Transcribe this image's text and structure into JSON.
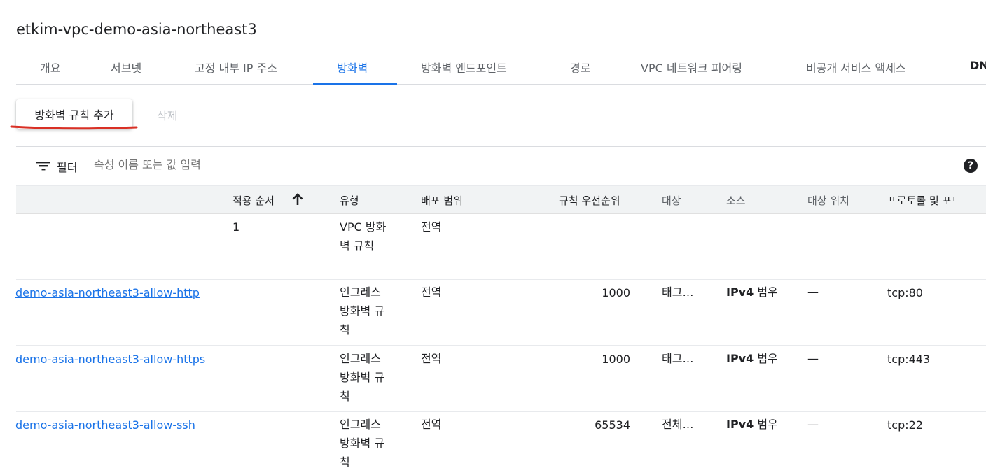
{
  "title": "etkim-vpc-demo-asia-northeast3",
  "tabs": [
    {
      "label": "개요"
    },
    {
      "label": "서브넷"
    },
    {
      "label": "고정 내부 IP 주소"
    },
    {
      "label": "방화벽"
    },
    {
      "label": "방화벽 엔드포인트"
    },
    {
      "label": "경로"
    },
    {
      "label": "VPC 네트워크 피어링"
    },
    {
      "label": "비공개 서비스 액세스"
    },
    {
      "label": "DN"
    }
  ],
  "active_tab": "방화벽",
  "toolbar": {
    "add_label": "방화벽 규칙 추가",
    "delete_label": "삭제"
  },
  "filter": {
    "label": "필터",
    "placeholder": "속성 이름 또는 값 입력"
  },
  "columns": {
    "order": "적용 순서",
    "type": "유형",
    "scope": "배포 범위",
    "priority": "규칙 우선순위",
    "target": "대상",
    "source": "소스",
    "target_location": "대상 위치",
    "protocol": "프로토콜 및 포트"
  },
  "rows": [
    {
      "name": "",
      "order": "1",
      "type": "VPC 방화벽 규칙",
      "scope": "전역",
      "priority": "",
      "target": "",
      "source_bold": "",
      "source_rest": "",
      "target_location": "",
      "protocol": ""
    },
    {
      "name": "demo-asia-northeast3-allow-http",
      "order": "",
      "type": "인그레스 방화벽 규칙",
      "scope": "전역",
      "priority": "1000",
      "target": "태그…",
      "source_bold": "IPv4",
      "source_rest": " 범우",
      "target_location": "—",
      "protocol": "tcp:80"
    },
    {
      "name": "demo-asia-northeast3-allow-https",
      "order": "",
      "type": "인그레스 방화벽 규칙",
      "scope": "전역",
      "priority": "1000",
      "target": "태그…",
      "source_bold": "IPv4",
      "source_rest": " 범우",
      "target_location": "—",
      "protocol": "tcp:443"
    },
    {
      "name": "demo-asia-northeast3-allow-ssh",
      "order": "",
      "type": "인그레스 방화벽 규칙",
      "scope": "전역",
      "priority": "65534",
      "target": "전체…",
      "source_bold": "IPv4",
      "source_rest": " 범우",
      "target_location": "—",
      "protocol": "tcp:22"
    }
  ],
  "colors": {
    "accent": "#1a73e8",
    "annotation": "#d93025",
    "header_bg": "#f1f3f4"
  },
  "icons": [
    "filter-icon",
    "help-icon",
    "arrow-up-icon"
  ]
}
